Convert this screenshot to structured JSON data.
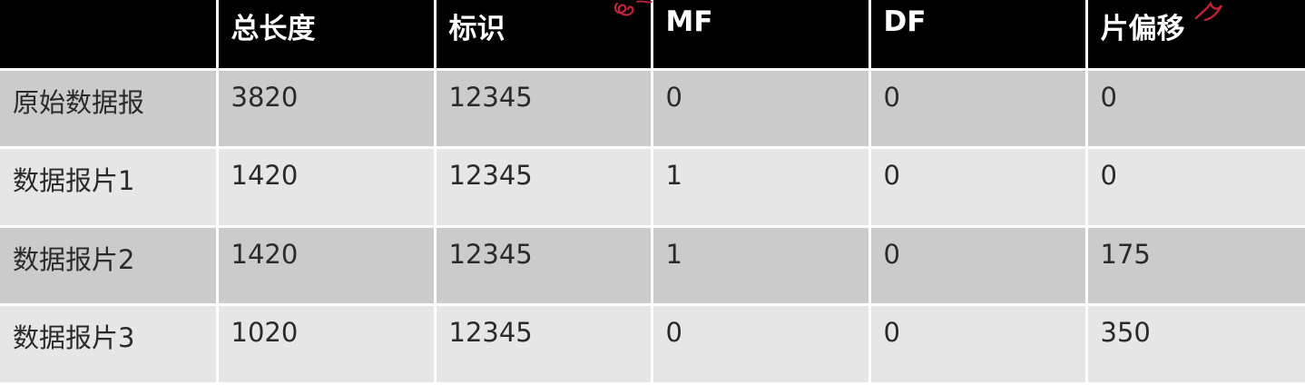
{
  "table": {
    "headers": [
      "",
      "总长度",
      "标识",
      "MF",
      "DF",
      "片偏移"
    ],
    "rows": [
      [
        "原始数据报",
        "3820",
        "12345",
        "0",
        "0",
        "0"
      ],
      [
        "数据报片1",
        "1420",
        "12345",
        "1",
        "0",
        "0"
      ],
      [
        "数据报片2",
        "1420",
        "12345",
        "1",
        "0",
        "175"
      ],
      [
        "数据报片3",
        "1020",
        "12345",
        "0",
        "0",
        "350"
      ]
    ]
  },
  "colors": {
    "header_bg": "#000000",
    "header_text": "#ffffff",
    "row_odd_bg": "#cbcbcb",
    "row_even_bg": "#e6e6e6",
    "annotation_ink": "#c0243a"
  }
}
